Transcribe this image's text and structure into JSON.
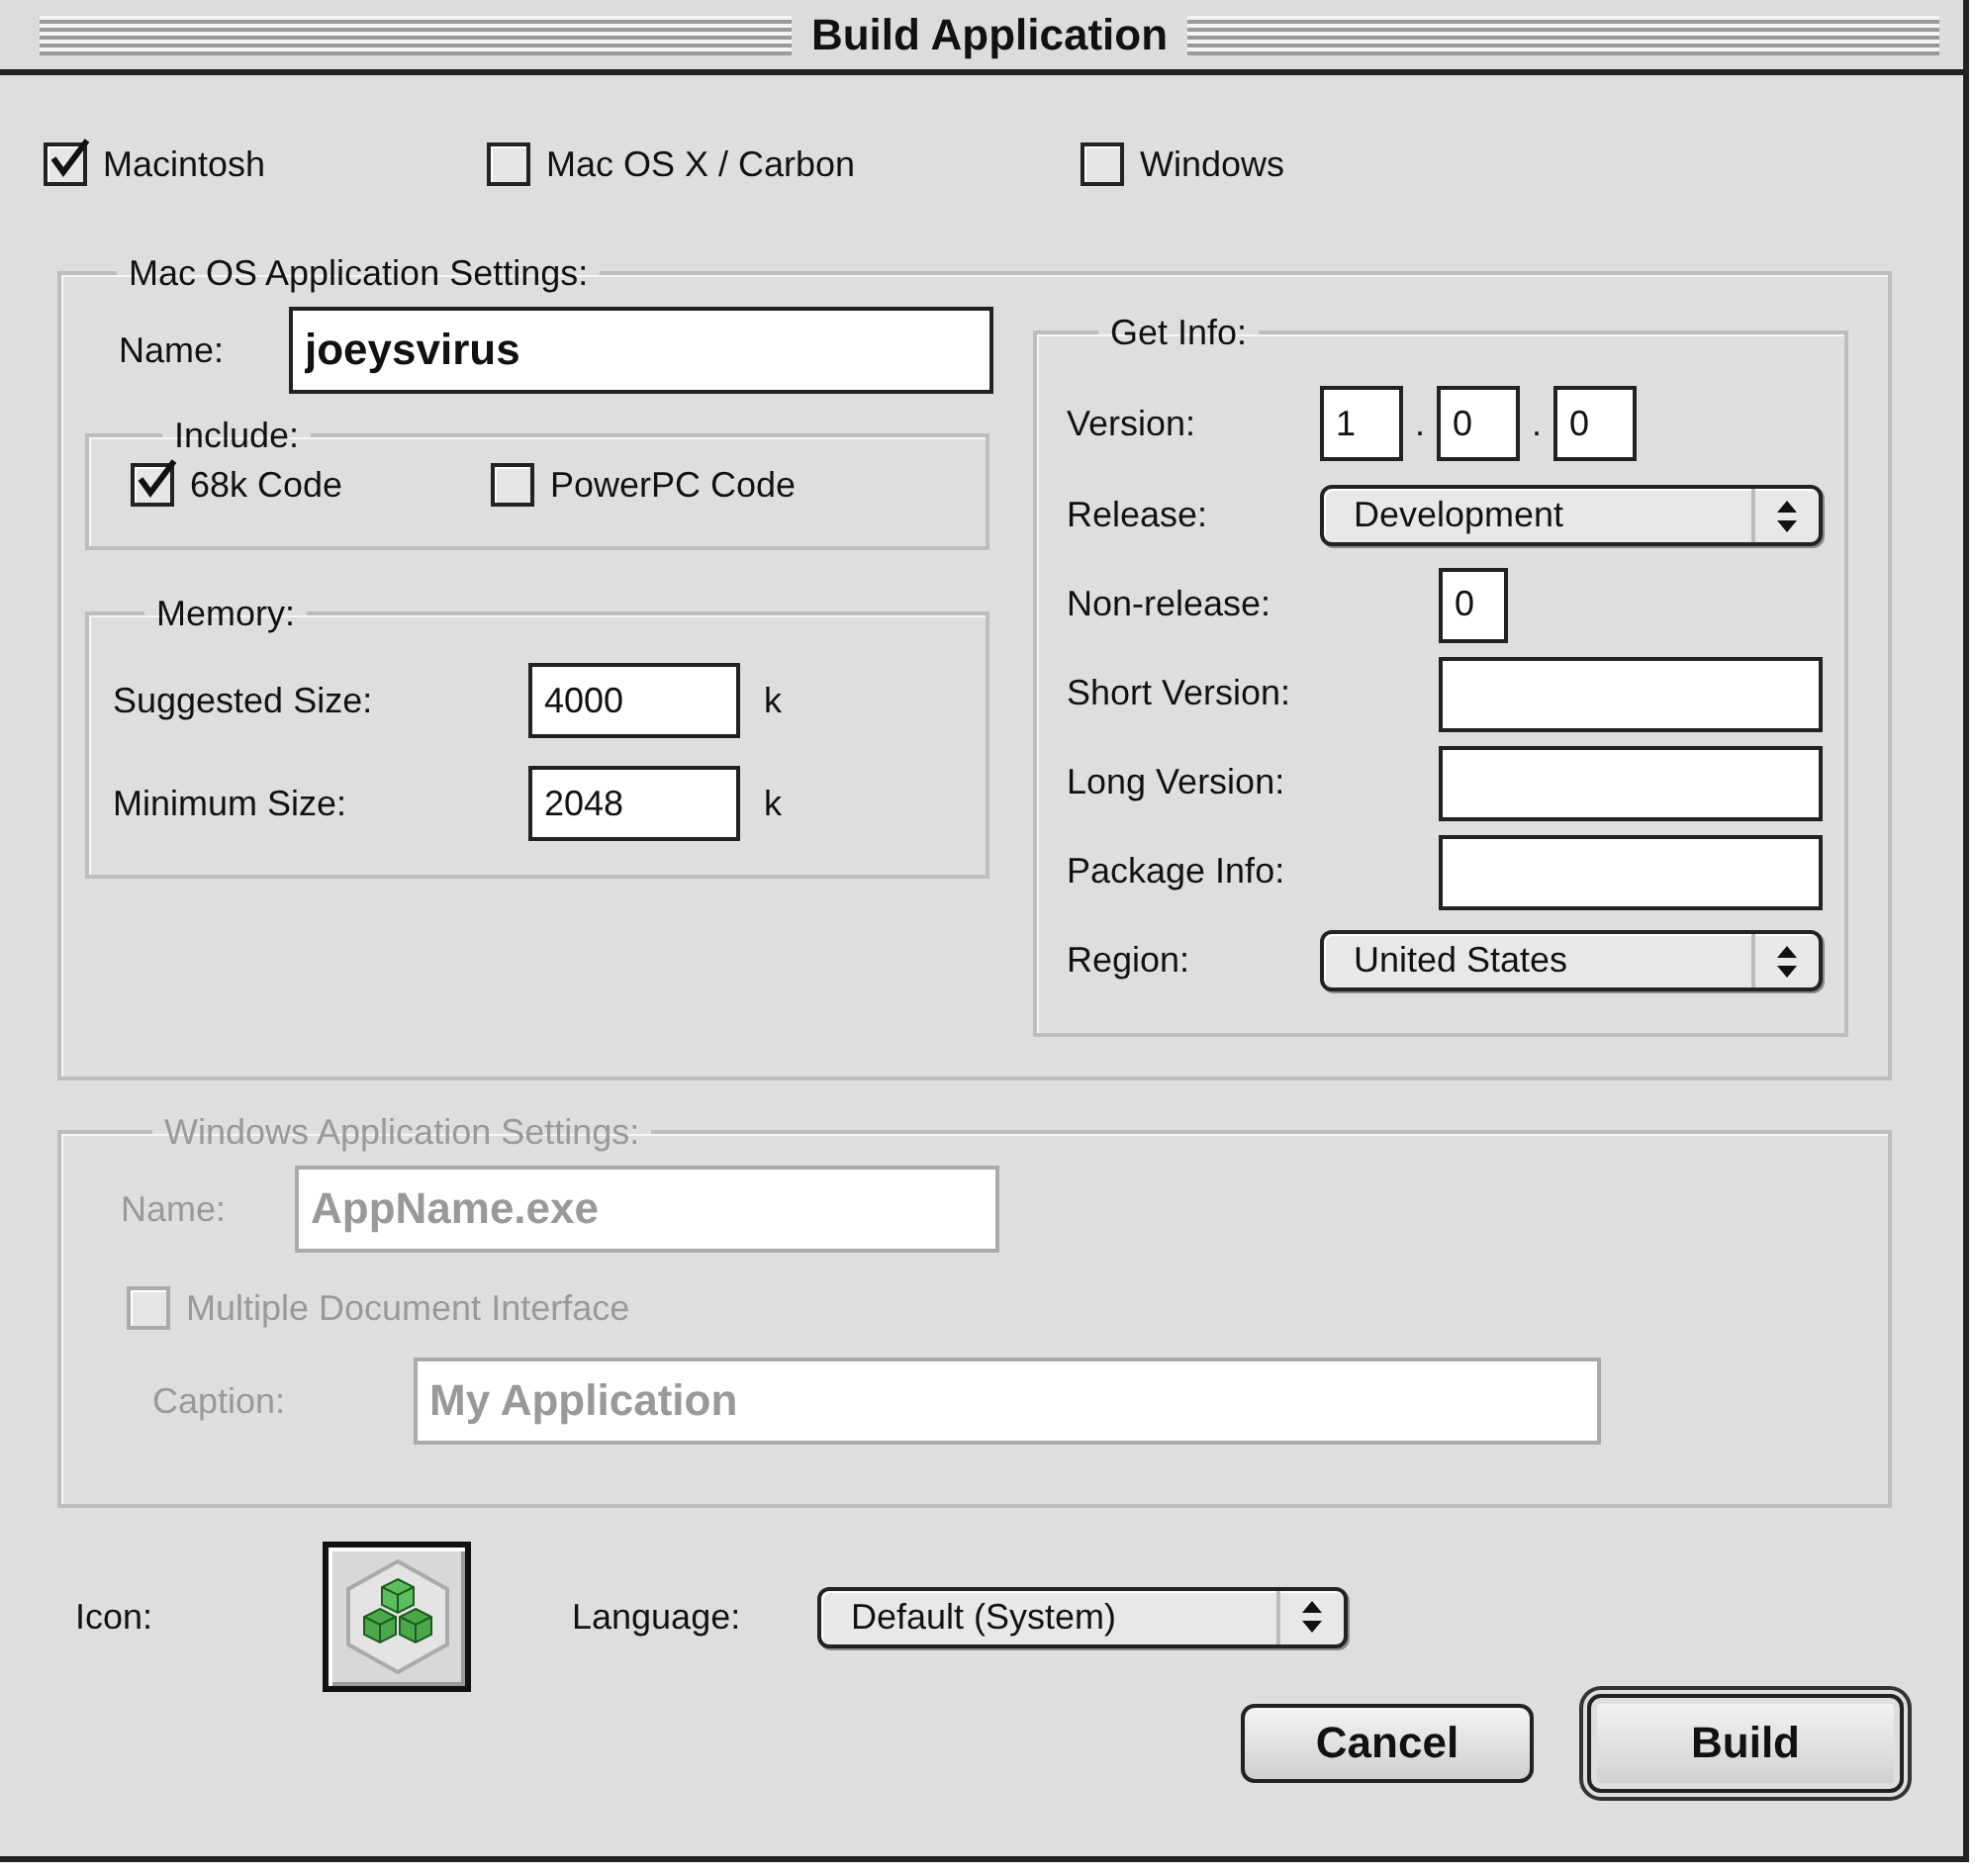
{
  "window": {
    "title": "Build Application"
  },
  "targets": [
    {
      "label": "Macintosh",
      "checked": true
    },
    {
      "label": "Mac OS X / Carbon",
      "checked": false
    },
    {
      "label": "Windows",
      "checked": false
    }
  ],
  "mac_settings": {
    "title": "Mac OS Application Settings:",
    "disabled": false,
    "name": {
      "label": "Name:",
      "value": "joeysvirus"
    },
    "include": {
      "title": "Include:",
      "options": [
        {
          "label": "68k Code",
          "checked": true
        },
        {
          "label": "PowerPC Code",
          "checked": false
        }
      ]
    },
    "memory": {
      "title": "Memory:",
      "rows": [
        {
          "label": "Suggested Size:",
          "value": "4000",
          "unit": "k"
        },
        {
          "label": "Minimum Size:",
          "value": "2048",
          "unit": "k"
        }
      ]
    },
    "get_info": {
      "title": "Get Info:",
      "rows": [
        {
          "kind": "version",
          "label": "Version:",
          "parts": [
            "1",
            "0",
            "0"
          ],
          "separator": "."
        },
        {
          "kind": "popup",
          "label": "Release:",
          "value": "Development"
        },
        {
          "kind": "number",
          "label": "Non-release:",
          "value": "0"
        },
        {
          "kind": "text",
          "label": "Short Version:"
        },
        {
          "kind": "text",
          "label": "Long Version:"
        },
        {
          "kind": "text",
          "label": "Package Info:"
        },
        {
          "kind": "popup",
          "label": "Region:",
          "value": "United States"
        }
      ]
    }
  },
  "windows_settings": {
    "title": "Windows Application Settings:",
    "disabled": true,
    "name": {
      "label": "Name:",
      "value": "AppName.exe"
    },
    "mdi": {
      "label": "Multiple Document Interface",
      "checked": false
    },
    "caption": {
      "label": "Caption:",
      "value": "My Application"
    }
  },
  "icon": {
    "label": "Icon:"
  },
  "language": {
    "label": "Language:",
    "value": "Default (System)"
  },
  "buttons": [
    {
      "label": "Cancel",
      "default": false
    },
    {
      "label": "Build",
      "default": true
    }
  ]
}
